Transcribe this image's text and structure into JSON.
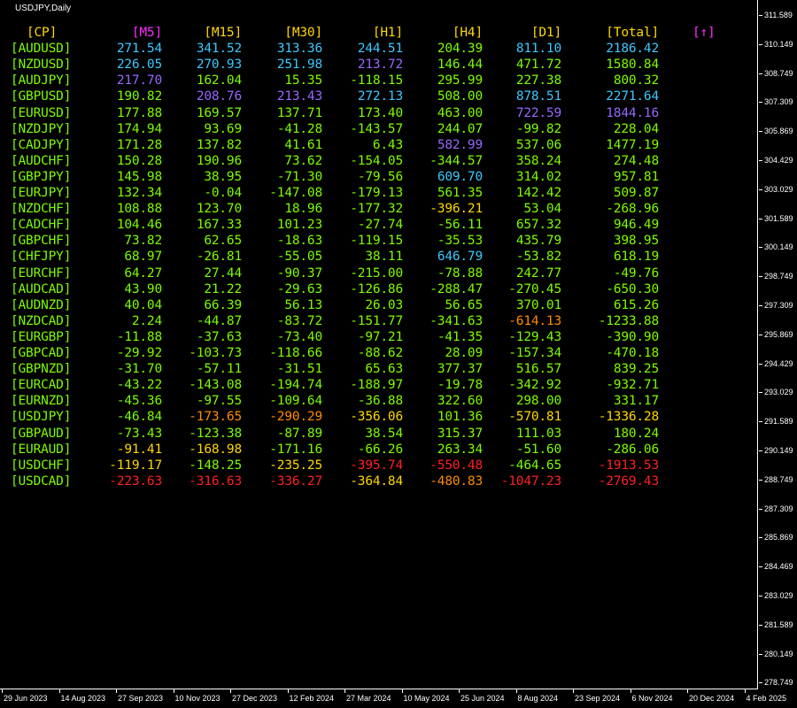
{
  "window": {
    "title": "USDJPY,Daily"
  },
  "colors": {
    "green": "#7CFC00",
    "gold": "#FFD700",
    "magenta": "#FF2BFF",
    "cyan": "#3CC8FF",
    "purple": "#9966FF",
    "orange": "#FF8C00",
    "red": "#FF2020"
  },
  "table": {
    "headers": [
      "[CP]",
      "[M5]",
      "[M15]",
      "[M30]",
      "[H1]",
      "[H4]",
      "[D1]",
      "[Total]",
      "[↑]"
    ],
    "rows": [
      {
        "symbol": "[AUDUSD]",
        "cells": [
          {
            "v": "271.54",
            "c": "cyan"
          },
          {
            "v": "341.52",
            "c": "cyan"
          },
          {
            "v": "313.36",
            "c": "cyan"
          },
          {
            "v": "244.51",
            "c": "cyan"
          },
          {
            "v": "204.39",
            "c": "green"
          },
          {
            "v": "811.10",
            "c": "cyan"
          },
          {
            "v": "2186.42",
            "c": "cyan"
          }
        ]
      },
      {
        "symbol": "[NZDUSD]",
        "cells": [
          {
            "v": "226.05",
            "c": "cyan"
          },
          {
            "v": "270.93",
            "c": "cyan"
          },
          {
            "v": "251.98",
            "c": "cyan"
          },
          {
            "v": "213.72",
            "c": "purple"
          },
          {
            "v": "146.44",
            "c": "green"
          },
          {
            "v": "471.72",
            "c": "green"
          },
          {
            "v": "1580.84",
            "c": "green"
          }
        ]
      },
      {
        "symbol": "[AUDJPY]",
        "cells": [
          {
            "v": "217.70",
            "c": "purple"
          },
          {
            "v": "162.04",
            "c": "green"
          },
          {
            "v": "15.35",
            "c": "green"
          },
          {
            "v": "-118.15",
            "c": "green"
          },
          {
            "v": "295.99",
            "c": "green"
          },
          {
            "v": "227.38",
            "c": "green"
          },
          {
            "v": "800.32",
            "c": "green"
          }
        ]
      },
      {
        "symbol": "[GBPUSD]",
        "cells": [
          {
            "v": "190.82",
            "c": "green"
          },
          {
            "v": "208.76",
            "c": "purple"
          },
          {
            "v": "213.43",
            "c": "purple"
          },
          {
            "v": "272.13",
            "c": "cyan"
          },
          {
            "v": "508.00",
            "c": "green"
          },
          {
            "v": "878.51",
            "c": "cyan"
          },
          {
            "v": "2271.64",
            "c": "cyan"
          }
        ]
      },
      {
        "symbol": "[EURUSD]",
        "cells": [
          {
            "v": "177.88",
            "c": "green"
          },
          {
            "v": "169.57",
            "c": "green"
          },
          {
            "v": "137.71",
            "c": "green"
          },
          {
            "v": "173.40",
            "c": "green"
          },
          {
            "v": "463.00",
            "c": "green"
          },
          {
            "v": "722.59",
            "c": "purple"
          },
          {
            "v": "1844.16",
            "c": "purple"
          }
        ]
      },
      {
        "symbol": "[NZDJPY]",
        "cells": [
          {
            "v": "174.94",
            "c": "green"
          },
          {
            "v": "93.69",
            "c": "green"
          },
          {
            "v": "-41.28",
            "c": "green"
          },
          {
            "v": "-143.57",
            "c": "green"
          },
          {
            "v": "244.07",
            "c": "green"
          },
          {
            "v": "-99.82",
            "c": "green"
          },
          {
            "v": "228.04",
            "c": "green"
          }
        ]
      },
      {
        "symbol": "[CADJPY]",
        "cells": [
          {
            "v": "171.28",
            "c": "green"
          },
          {
            "v": "137.82",
            "c": "green"
          },
          {
            "v": "41.61",
            "c": "green"
          },
          {
            "v": "6.43",
            "c": "green"
          },
          {
            "v": "582.99",
            "c": "purple"
          },
          {
            "v": "537.06",
            "c": "green"
          },
          {
            "v": "1477.19",
            "c": "green"
          }
        ]
      },
      {
        "symbol": "[AUDCHF]",
        "cells": [
          {
            "v": "150.28",
            "c": "green"
          },
          {
            "v": "190.96",
            "c": "green"
          },
          {
            "v": "73.62",
            "c": "green"
          },
          {
            "v": "-154.05",
            "c": "green"
          },
          {
            "v": "-344.57",
            "c": "green"
          },
          {
            "v": "358.24",
            "c": "green"
          },
          {
            "v": "274.48",
            "c": "green"
          }
        ]
      },
      {
        "symbol": "[GBPJPY]",
        "cells": [
          {
            "v": "145.98",
            "c": "green"
          },
          {
            "v": "38.95",
            "c": "green"
          },
          {
            "v": "-71.30",
            "c": "green"
          },
          {
            "v": "-79.56",
            "c": "green"
          },
          {
            "v": "609.70",
            "c": "cyan"
          },
          {
            "v": "314.02",
            "c": "green"
          },
          {
            "v": "957.81",
            "c": "green"
          }
        ]
      },
      {
        "symbol": "[EURJPY]",
        "cells": [
          {
            "v": "132.34",
            "c": "green"
          },
          {
            "v": "-0.04",
            "c": "green"
          },
          {
            "v": "-147.08",
            "c": "green"
          },
          {
            "v": "-179.13",
            "c": "green"
          },
          {
            "v": "561.35",
            "c": "green"
          },
          {
            "v": "142.42",
            "c": "green"
          },
          {
            "v": "509.87",
            "c": "green"
          }
        ]
      },
      {
        "symbol": "[NZDCHF]",
        "cells": [
          {
            "v": "108.88",
            "c": "green"
          },
          {
            "v": "123.70",
            "c": "green"
          },
          {
            "v": "18.96",
            "c": "green"
          },
          {
            "v": "-177.32",
            "c": "green"
          },
          {
            "v": "-396.21",
            "c": "gold"
          },
          {
            "v": "53.04",
            "c": "green"
          },
          {
            "v": "-268.96",
            "c": "green"
          }
        ]
      },
      {
        "symbol": "[CADCHF]",
        "cells": [
          {
            "v": "104.46",
            "c": "green"
          },
          {
            "v": "167.33",
            "c": "green"
          },
          {
            "v": "101.23",
            "c": "green"
          },
          {
            "v": "-27.74",
            "c": "green"
          },
          {
            "v": "-56.11",
            "c": "green"
          },
          {
            "v": "657.32",
            "c": "green"
          },
          {
            "v": "946.49",
            "c": "green"
          }
        ]
      },
      {
        "symbol": "[GBPCHF]",
        "cells": [
          {
            "v": "73.82",
            "c": "green"
          },
          {
            "v": "62.65",
            "c": "green"
          },
          {
            "v": "-18.63",
            "c": "green"
          },
          {
            "v": "-119.15",
            "c": "green"
          },
          {
            "v": "-35.53",
            "c": "green"
          },
          {
            "v": "435.79",
            "c": "green"
          },
          {
            "v": "398.95",
            "c": "green"
          }
        ]
      },
      {
        "symbol": "[CHFJPY]",
        "cells": [
          {
            "v": "68.97",
            "c": "green"
          },
          {
            "v": "-26.81",
            "c": "green"
          },
          {
            "v": "-55.05",
            "c": "green"
          },
          {
            "v": "38.11",
            "c": "green"
          },
          {
            "v": "646.79",
            "c": "cyan"
          },
          {
            "v": "-53.82",
            "c": "green"
          },
          {
            "v": "618.19",
            "c": "green"
          }
        ]
      },
      {
        "symbol": "[EURCHF]",
        "cells": [
          {
            "v": "64.27",
            "c": "green"
          },
          {
            "v": "27.44",
            "c": "green"
          },
          {
            "v": "-90.37",
            "c": "green"
          },
          {
            "v": "-215.00",
            "c": "green"
          },
          {
            "v": "-78.88",
            "c": "green"
          },
          {
            "v": "242.77",
            "c": "green"
          },
          {
            "v": "-49.76",
            "c": "green"
          }
        ]
      },
      {
        "symbol": "[AUDCAD]",
        "cells": [
          {
            "v": "43.90",
            "c": "green"
          },
          {
            "v": "21.22",
            "c": "green"
          },
          {
            "v": "-29.63",
            "c": "green"
          },
          {
            "v": "-126.86",
            "c": "green"
          },
          {
            "v": "-288.47",
            "c": "green"
          },
          {
            "v": "-270.45",
            "c": "green"
          },
          {
            "v": "-650.30",
            "c": "green"
          }
        ]
      },
      {
        "symbol": "[AUDNZD]",
        "cells": [
          {
            "v": "40.04",
            "c": "green"
          },
          {
            "v": "66.39",
            "c": "green"
          },
          {
            "v": "56.13",
            "c": "green"
          },
          {
            "v": "26.03",
            "c": "green"
          },
          {
            "v": "56.65",
            "c": "green"
          },
          {
            "v": "370.01",
            "c": "green"
          },
          {
            "v": "615.26",
            "c": "green"
          }
        ]
      },
      {
        "symbol": "[NZDCAD]",
        "cells": [
          {
            "v": "2.24",
            "c": "green"
          },
          {
            "v": "-44.87",
            "c": "green"
          },
          {
            "v": "-83.72",
            "c": "green"
          },
          {
            "v": "-151.77",
            "c": "green"
          },
          {
            "v": "-341.63",
            "c": "green"
          },
          {
            "v": "-614.13",
            "c": "orange"
          },
          {
            "v": "-1233.88",
            "c": "green"
          }
        ]
      },
      {
        "symbol": "[EURGBP]",
        "cells": [
          {
            "v": "-11.88",
            "c": "green"
          },
          {
            "v": "-37.63",
            "c": "green"
          },
          {
            "v": "-73.40",
            "c": "green"
          },
          {
            "v": "-97.21",
            "c": "green"
          },
          {
            "v": "-41.35",
            "c": "green"
          },
          {
            "v": "-129.43",
            "c": "green"
          },
          {
            "v": "-390.90",
            "c": "green"
          }
        ]
      },
      {
        "symbol": "[GBPCAD]",
        "cells": [
          {
            "v": "-29.92",
            "c": "green"
          },
          {
            "v": "-103.73",
            "c": "green"
          },
          {
            "v": "-118.66",
            "c": "green"
          },
          {
            "v": "-88.62",
            "c": "green"
          },
          {
            "v": "28.09",
            "c": "green"
          },
          {
            "v": "-157.34",
            "c": "green"
          },
          {
            "v": "-470.18",
            "c": "green"
          }
        ]
      },
      {
        "symbol": "[GBPNZD]",
        "cells": [
          {
            "v": "-31.70",
            "c": "green"
          },
          {
            "v": "-57.11",
            "c": "green"
          },
          {
            "v": "-31.51",
            "c": "green"
          },
          {
            "v": "65.63",
            "c": "green"
          },
          {
            "v": "377.37",
            "c": "green"
          },
          {
            "v": "516.57",
            "c": "green"
          },
          {
            "v": "839.25",
            "c": "green"
          }
        ]
      },
      {
        "symbol": "[EURCAD]",
        "cells": [
          {
            "v": "-43.22",
            "c": "green"
          },
          {
            "v": "-143.08",
            "c": "green"
          },
          {
            "v": "-194.74",
            "c": "green"
          },
          {
            "v": "-188.97",
            "c": "green"
          },
          {
            "v": "-19.78",
            "c": "green"
          },
          {
            "v": "-342.92",
            "c": "green"
          },
          {
            "v": "-932.71",
            "c": "green"
          }
        ]
      },
      {
        "symbol": "[EURNZD]",
        "cells": [
          {
            "v": "-45.36",
            "c": "green"
          },
          {
            "v": "-97.55",
            "c": "green"
          },
          {
            "v": "-109.64",
            "c": "green"
          },
          {
            "v": "-36.88",
            "c": "green"
          },
          {
            "v": "322.60",
            "c": "green"
          },
          {
            "v": "298.00",
            "c": "green"
          },
          {
            "v": "331.17",
            "c": "green"
          }
        ]
      },
      {
        "symbol": "[USDJPY]",
        "cells": [
          {
            "v": "-46.84",
            "c": "green"
          },
          {
            "v": "-173.65",
            "c": "orange"
          },
          {
            "v": "-290.29",
            "c": "orange"
          },
          {
            "v": "-356.06",
            "c": "gold"
          },
          {
            "v": "101.36",
            "c": "green"
          },
          {
            "v": "-570.81",
            "c": "gold"
          },
          {
            "v": "-1336.28",
            "c": "gold"
          }
        ]
      },
      {
        "symbol": "[GBPAUD]",
        "cells": [
          {
            "v": "-73.43",
            "c": "green"
          },
          {
            "v": "-123.38",
            "c": "green"
          },
          {
            "v": "-87.89",
            "c": "green"
          },
          {
            "v": "38.54",
            "c": "green"
          },
          {
            "v": "315.37",
            "c": "green"
          },
          {
            "v": "111.03",
            "c": "green"
          },
          {
            "v": "180.24",
            "c": "green"
          }
        ]
      },
      {
        "symbol": "[EURAUD]",
        "cells": [
          {
            "v": "-91.41",
            "c": "gold"
          },
          {
            "v": "-168.98",
            "c": "gold"
          },
          {
            "v": "-171.16",
            "c": "green"
          },
          {
            "v": "-66.26",
            "c": "green"
          },
          {
            "v": "263.34",
            "c": "green"
          },
          {
            "v": "-51.60",
            "c": "green"
          },
          {
            "v": "-286.06",
            "c": "green"
          }
        ]
      },
      {
        "symbol": "[USDCHF]",
        "cells": [
          {
            "v": "-119.17",
            "c": "gold"
          },
          {
            "v": "-148.25",
            "c": "green"
          },
          {
            "v": "-235.25",
            "c": "gold"
          },
          {
            "v": "-395.74",
            "c": "red"
          },
          {
            "v": "-550.48",
            "c": "red"
          },
          {
            "v": "-464.65",
            "c": "green"
          },
          {
            "v": "-1913.53",
            "c": "red"
          }
        ]
      },
      {
        "symbol": "[USDCAD]",
        "cells": [
          {
            "v": "-223.63",
            "c": "red"
          },
          {
            "v": "-316.63",
            "c": "red"
          },
          {
            "v": "-336.27",
            "c": "red"
          },
          {
            "v": "-364.84",
            "c": "gold"
          },
          {
            "v": "-480.83",
            "c": "orange"
          },
          {
            "v": "-1047.23",
            "c": "red"
          },
          {
            "v": "-2769.43",
            "c": "red"
          }
        ]
      }
    ]
  },
  "price_axis": [
    "311.589",
    "310.149",
    "308.749",
    "307.309",
    "305.869",
    "304.429",
    "303.029",
    "301.589",
    "300.149",
    "298.749",
    "297.309",
    "295.869",
    "294.429",
    "293.029",
    "291.589",
    "290.149",
    "288.749",
    "287.309",
    "285.869",
    "284.469",
    "283.029",
    "281.589",
    "280.149",
    "278.749"
  ],
  "time_axis": [
    "29 Jun 2023",
    "14 Aug 2023",
    "27 Sep 2023",
    "10 Nov 2023",
    "27 Dec 2023",
    "12 Feb 2024",
    "27 Mar 2024",
    "10 May 2024",
    "25 Jun 2024",
    "8 Aug 2024",
    "23 Sep 2024",
    "6 Nov 2024",
    "20 Dec 2024",
    "4 Feb 2025"
  ]
}
